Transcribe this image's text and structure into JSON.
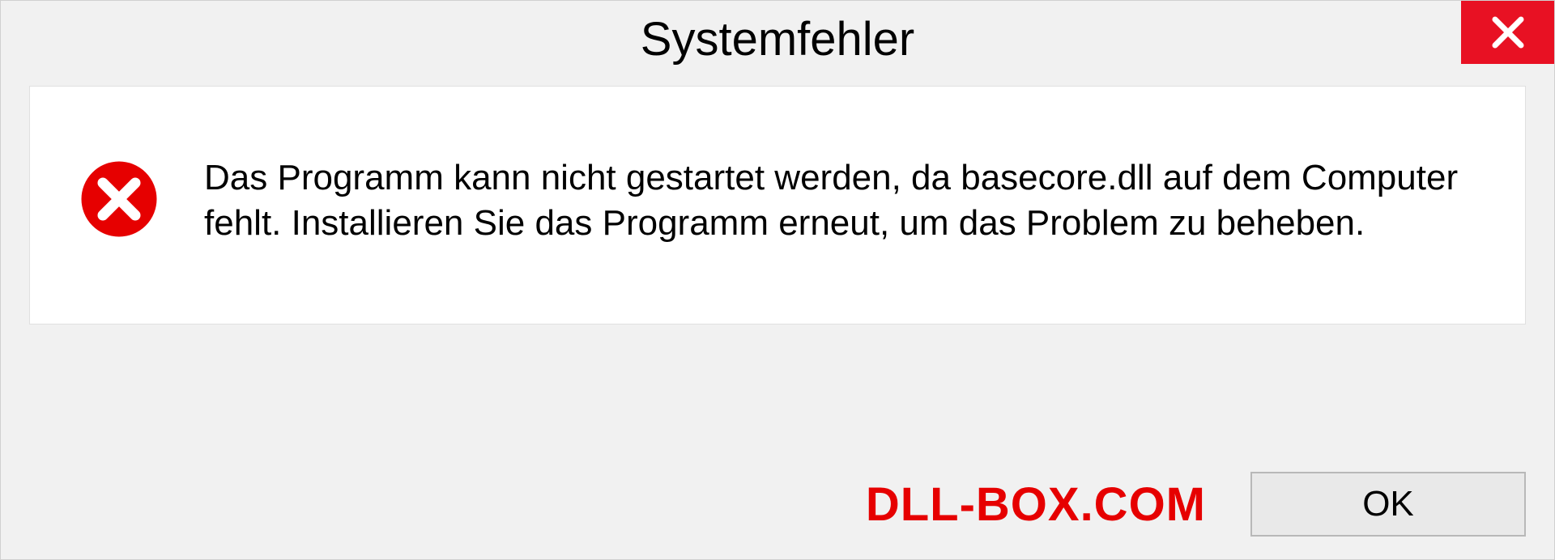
{
  "dialog": {
    "title": "Systemfehler",
    "message": "Das Programm kann nicht gestartet werden, da basecore.dll auf dem Computer fehlt. Installieren Sie das Programm erneut, um das Problem zu beheben.",
    "ok_label": "OK"
  },
  "watermark": "DLL-BOX.COM"
}
